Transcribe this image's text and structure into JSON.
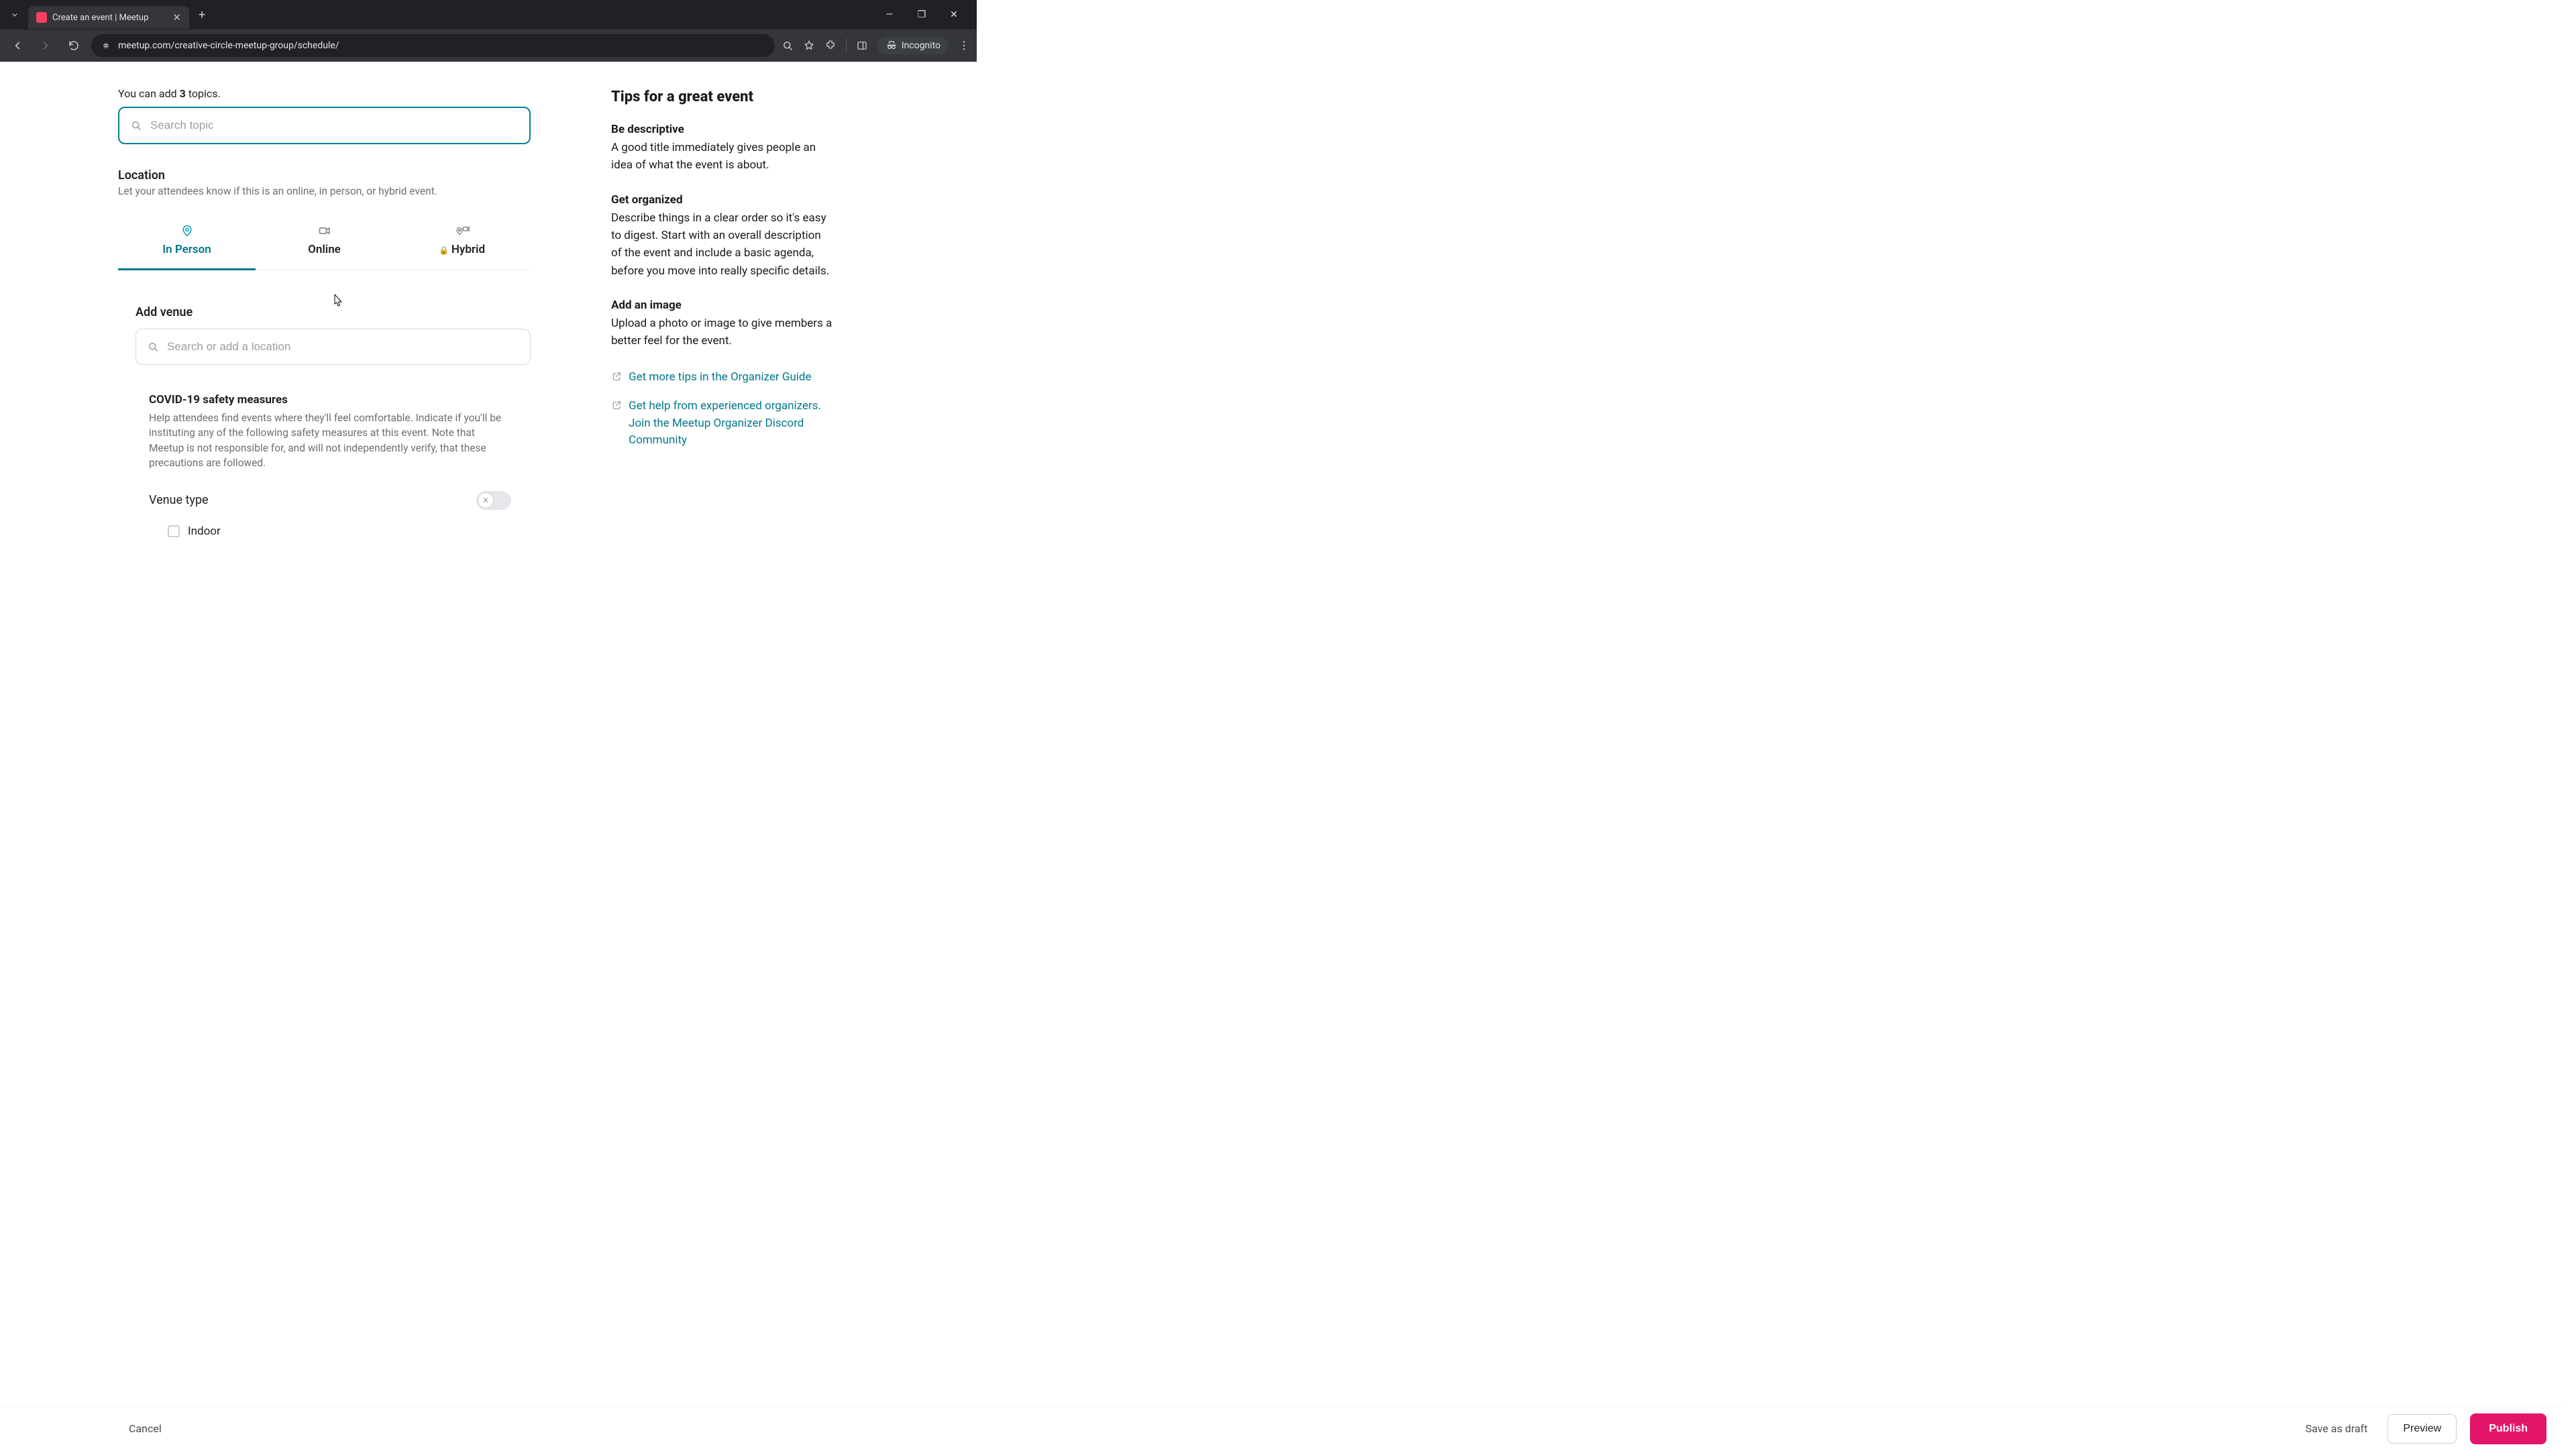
{
  "browser": {
    "tab_title": "Create an event | Meetup",
    "url": "meetup.com/creative-circle-meetup-group/schedule/",
    "incognito_label": "Incognito"
  },
  "topics": {
    "hint_prefix": "You can add ",
    "hint_count": "3",
    "hint_suffix": " topics.",
    "search_placeholder": "Search topic"
  },
  "location": {
    "title": "Location",
    "subtitle": "Let your attendees know if this is an online, in person, or hybrid event.",
    "tabs": {
      "in_person": "In Person",
      "online": "Online",
      "hybrid": "Hybrid"
    }
  },
  "venue": {
    "title": "Add venue",
    "search_placeholder": "Search or add a location"
  },
  "covid": {
    "title": "COVID-19 safety measures",
    "desc": "Help attendees find events where they'll feel comfortable. Indicate if you'll be instituting any of the following safety measures at this event. Note that Meetup is not responsible for, and will not independently verify, that these precautions are followed.",
    "venue_type_label": "Venue type",
    "indoor_label": "Indoor"
  },
  "tips": {
    "title": "Tips for a great event",
    "items": [
      {
        "heading": "Be descriptive",
        "body": "A good title immediately gives people an idea of what the event is about."
      },
      {
        "heading": "Get organized",
        "body": "Describe things in a clear order so it's easy to digest. Start with an overall description of the event and include a basic agenda, before you move into really specific details."
      },
      {
        "heading": "Add an image",
        "body": "Upload a photo or image to give members a better feel for the event."
      }
    ],
    "link1": "Get more tips in the Organizer Guide",
    "link2": "Get help from experienced organizers. Join the Meetup Organizer Discord Community"
  },
  "footer": {
    "cancel": "Cancel",
    "save_draft": "Save as draft",
    "preview": "Preview",
    "publish": "Publish"
  }
}
